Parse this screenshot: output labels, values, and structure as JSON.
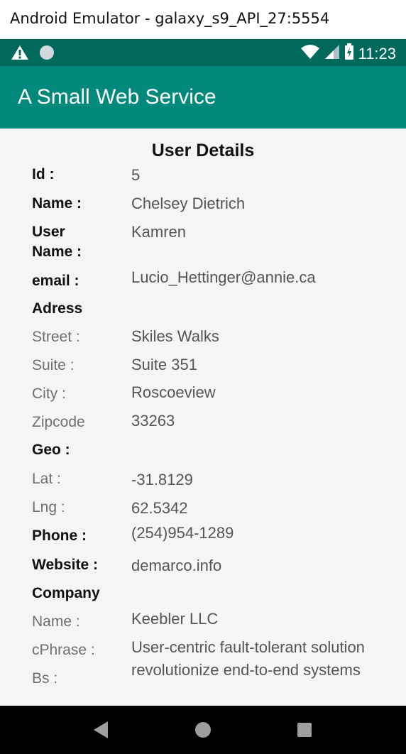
{
  "window": {
    "title": "Android Emulator - galaxy_s9_API_27:5554"
  },
  "status_bar": {
    "time": "11:23",
    "icons": [
      "warning-icon",
      "circle-icon",
      "wifi-icon",
      "signal-icon",
      "battery-icon"
    ]
  },
  "app_bar": {
    "title": "A Small Web Service"
  },
  "details": {
    "heading": "User Details",
    "id": {
      "label": "Id :",
      "value": "5"
    },
    "name": {
      "label": "Name :",
      "value": "Chelsey Dietrich"
    },
    "username": {
      "label_line1": "User",
      "label_line2": "Name :",
      "value": "Kamren"
    },
    "email": {
      "label": "email :",
      "value": "Lucio_Hettinger@annie.ca"
    },
    "address": {
      "label": "Adress",
      "street": {
        "label": "Street :",
        "value": "Skiles Walks"
      },
      "suite": {
        "label": "Suite :",
        "value": "Suite 351"
      },
      "city": {
        "label": "City :",
        "value": "Roscoeview"
      },
      "zipcode": {
        "label": "Zipcode",
        "value": "33263"
      }
    },
    "geo": {
      "label": "Geo :",
      "lat": {
        "label": "Lat :",
        "value": "-31.8129"
      },
      "lng": {
        "label": "Lng :",
        "value": "62.5342"
      }
    },
    "phone": {
      "label": "Phone :",
      "value": "(254)954-1289"
    },
    "website": {
      "label": "Website :",
      "value": "demarco.info"
    },
    "company": {
      "label": "Company",
      "name": {
        "label": "Name :",
        "value": "Keebler LLC"
      },
      "cphrase": {
        "label": "cPhrase :",
        "value": "User-centric fault-tolerant solution"
      },
      "bs": {
        "label": "Bs :",
        "value": "revolutionize end-to-end systems"
      }
    }
  },
  "nav_bar": {
    "buttons": [
      "back-icon",
      "home-icon",
      "recents-icon"
    ]
  },
  "colors": {
    "status_bar": "#00695c",
    "app_bar": "#00897b",
    "content_bg": "#f5f5f5",
    "nav_bar": "#000000"
  }
}
